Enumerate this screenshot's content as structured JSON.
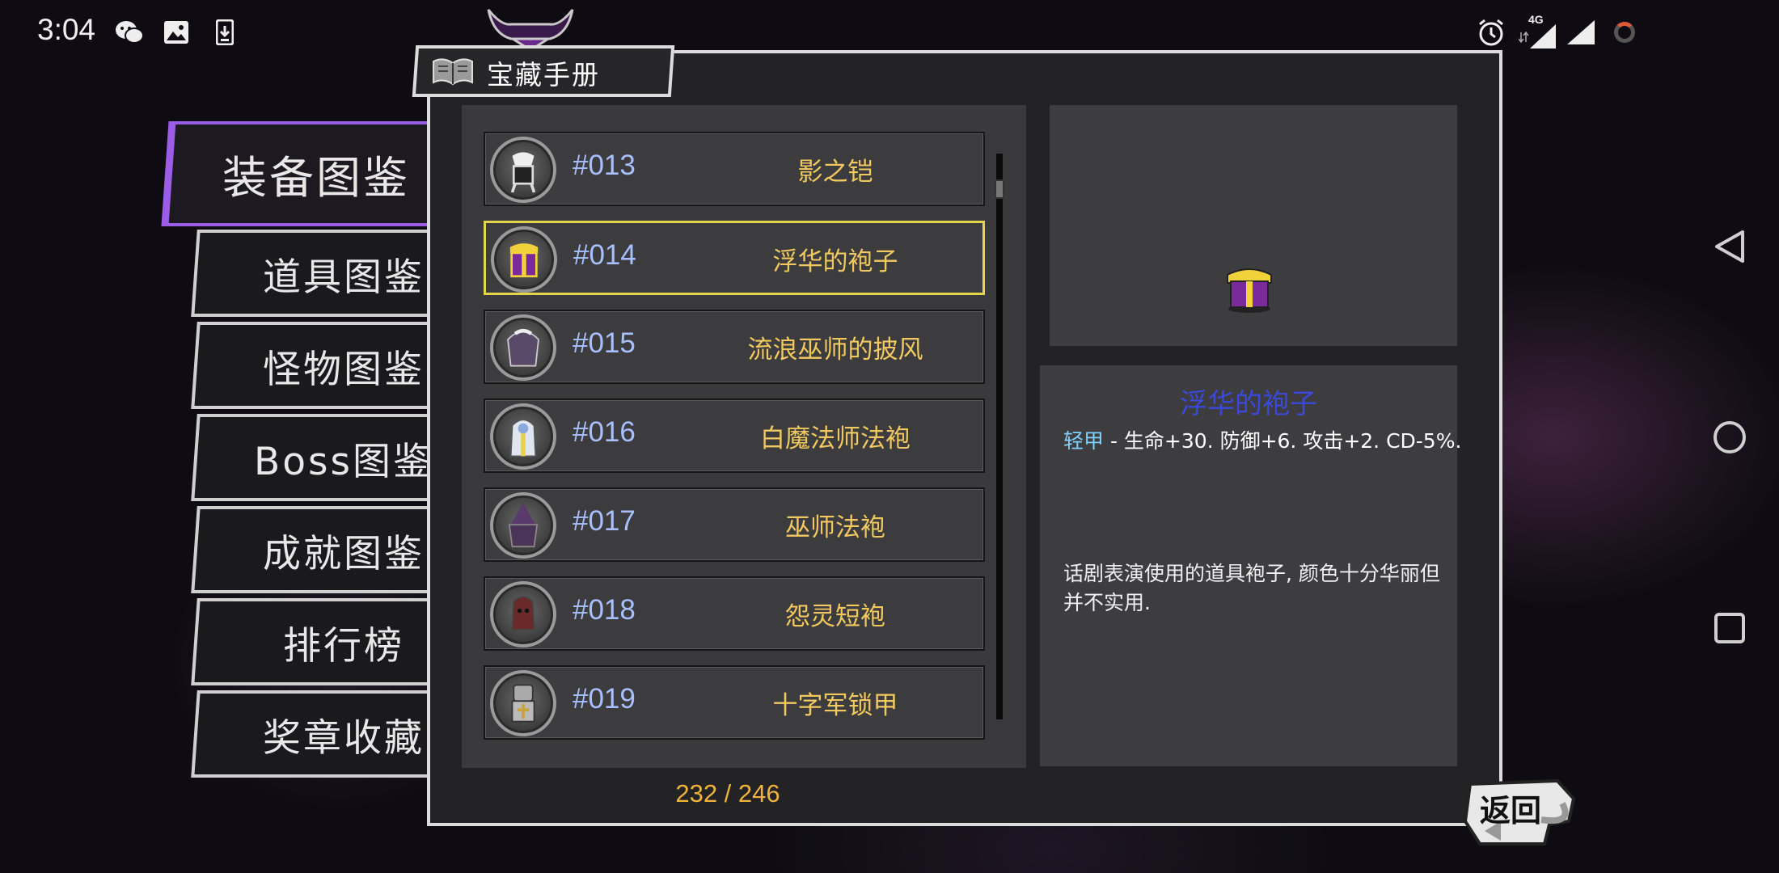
{
  "status_bar": {
    "time": "3:04",
    "left_icons": [
      "wechat-icon",
      "image-icon",
      "download-icon"
    ],
    "right_icons": [
      "alarm-icon",
      "signal-4g-icon",
      "signal-icon",
      "battery-charging-icon"
    ],
    "network_label": "4G"
  },
  "nav_bar": {
    "buttons": [
      "back-triangle-icon",
      "home-circle-icon",
      "recents-square-icon"
    ]
  },
  "header": {
    "title": "宝藏手册",
    "icon": "book-icon"
  },
  "tabs": [
    {
      "label": "装备图鉴",
      "active": true
    },
    {
      "label": "道具图鉴",
      "active": false
    },
    {
      "label": "怪物图鉴",
      "active": false
    },
    {
      "label": "Boss图鉴",
      "active": false
    },
    {
      "label": "成就图鉴",
      "active": false
    },
    {
      "label": "排行榜",
      "active": false
    },
    {
      "label": "奖章收藏",
      "active": false
    }
  ],
  "list": {
    "items": [
      {
        "number": "#013",
        "name": "影之铠",
        "icon": "shadow-armor-icon",
        "selected": false
      },
      {
        "number": "#014",
        "name": "浮华的袍子",
        "icon": "fancy-robe-icon",
        "selected": true
      },
      {
        "number": "#015",
        "name": "流浪巫师的披风",
        "icon": "wanderer-cloak-icon",
        "selected": false
      },
      {
        "number": "#016",
        "name": "白魔法师法袍",
        "icon": "white-mage-robe-icon",
        "selected": false
      },
      {
        "number": "#017",
        "name": "巫师法袍",
        "icon": "wizard-robe-icon",
        "selected": false
      },
      {
        "number": "#018",
        "name": "怨灵短袍",
        "icon": "wraith-robe-icon",
        "selected": false
      },
      {
        "number": "#019",
        "name": "十字军锁甲",
        "icon": "crusader-mail-icon",
        "selected": false
      }
    ],
    "counter": "232 / 246"
  },
  "detail": {
    "preview_icon": "fancy-robe-icon",
    "title": "浮华的袍子",
    "type": "轻甲",
    "stats": " - 生命+30. 防御+6. 攻击+2. CD-5%.",
    "description": "话剧表演使用的道具袍子, 颜色十分华丽但并不实用."
  },
  "back_button": {
    "label": "返回"
  },
  "colors": {
    "accent_purple": "#9b5de5",
    "selected_border": "#e5d54a",
    "number_blue": "#a8c0ff",
    "name_gold": "#f2c960",
    "title_blue": "#3b48d8",
    "counter_orange": "#f0b43c"
  }
}
